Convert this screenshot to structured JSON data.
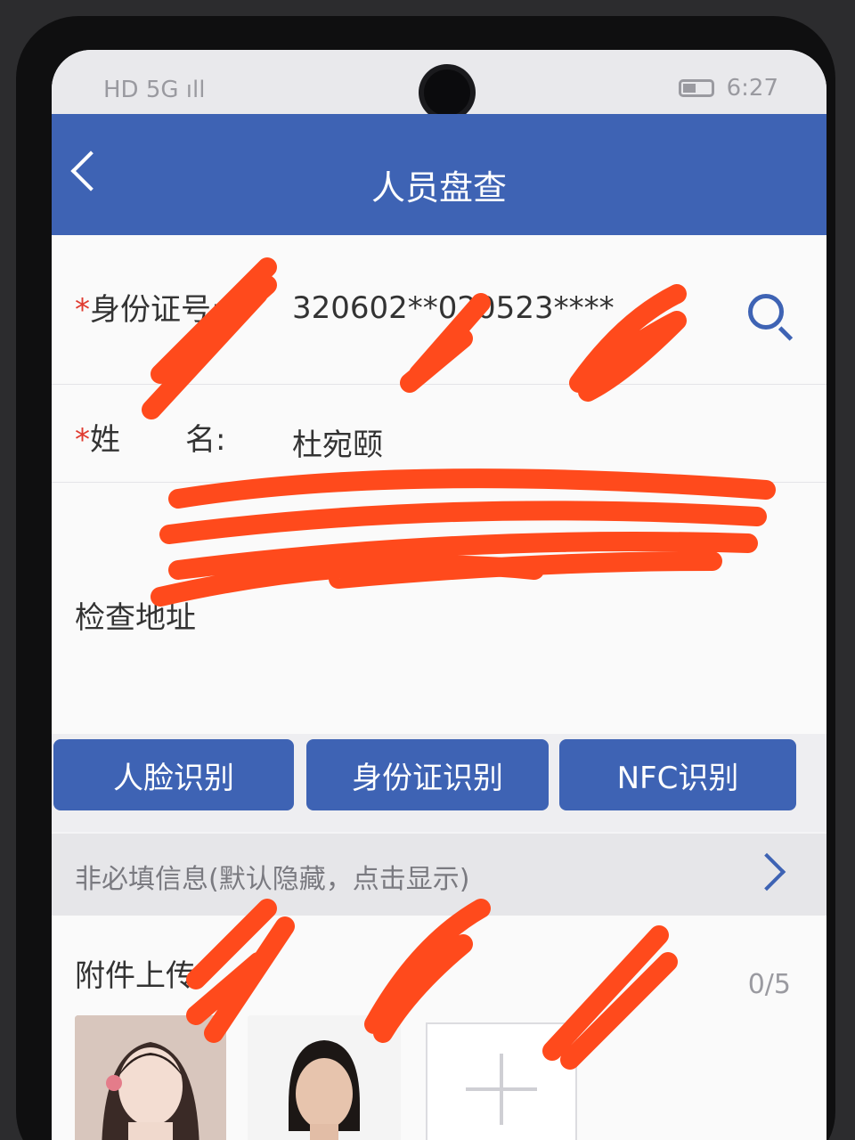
{
  "statusbar": {
    "left": "HD 5G ıll",
    "time": "6:27"
  },
  "header": {
    "title": "人员盘查"
  },
  "form": {
    "id_label": "身份证号:",
    "id_value": "320602**020523****",
    "name_label": "姓",
    "name_label2": "名:",
    "name_value": "杜宛颐",
    "address_label": "检查地址",
    "required_mark": "*"
  },
  "buttons": {
    "face": "人脸识别",
    "idcard": "身份证识别",
    "nfc": "NFC识别"
  },
  "optional": {
    "text": "非必填信息(默认隐藏，点击显示)"
  },
  "attachments": {
    "label": "附件上传:",
    "count": "0/5"
  },
  "colors": {
    "primary": "#3e63b4",
    "redaction": "#ff4a1c",
    "required": "#e03a2f"
  }
}
